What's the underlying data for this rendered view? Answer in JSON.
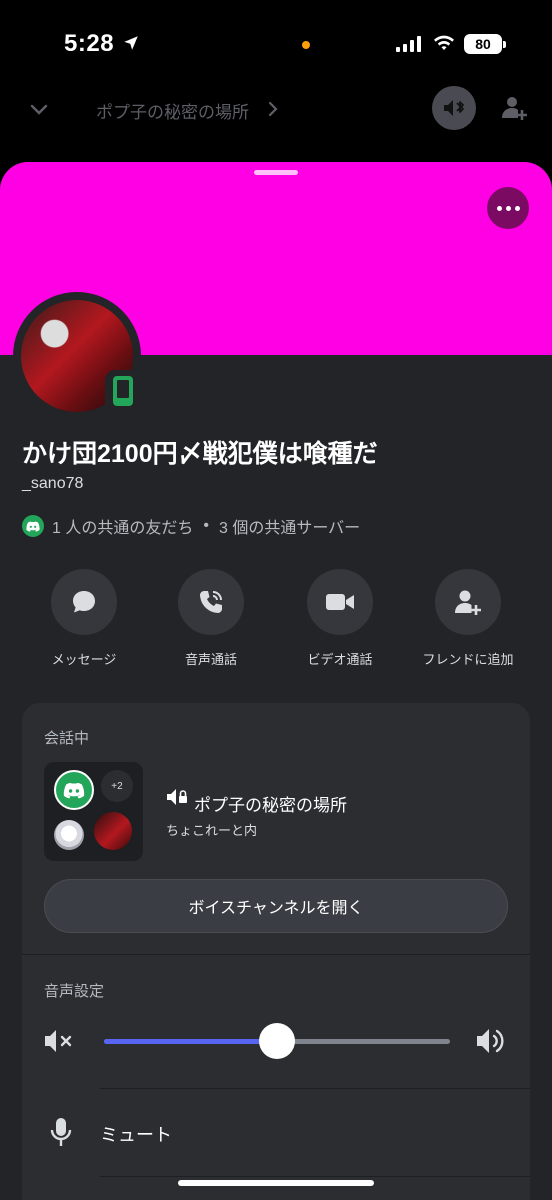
{
  "status_bar": {
    "time": "5:28",
    "battery": "80"
  },
  "nav": {
    "channel_title": "ポプ子の秘密の場所"
  },
  "profile": {
    "banner_color": "#ff00e5",
    "display_name": "かけ団2100円〆戦犯僕は喰種だ",
    "username": "_sano78",
    "mutual_friends": "1 人の共通の友だち",
    "separator": "•",
    "mutual_servers": "3 個の共通サーバー"
  },
  "actions": [
    {
      "label": "メッセージ",
      "icon": "message-icon"
    },
    {
      "label": "音声通話",
      "icon": "phone-call-icon"
    },
    {
      "label": "ビデオ通話",
      "icon": "video-icon"
    },
    {
      "label": "フレンドに追加",
      "icon": "add-friend-icon"
    }
  ],
  "voice": {
    "heading": "会話中",
    "more_count": "+2",
    "channel_name": "ポプ子の秘密の場所",
    "members": "ちょこれーと内",
    "open_button": "ボイスチャンネルを開く"
  },
  "audio": {
    "heading": "音声設定",
    "volume_fraction": 0.5,
    "mute_label": "ミュート"
  },
  "colors": {
    "accent": "#5865f2",
    "online": "#23a55a",
    "sheet": "#232428",
    "card": "#2b2d31"
  }
}
